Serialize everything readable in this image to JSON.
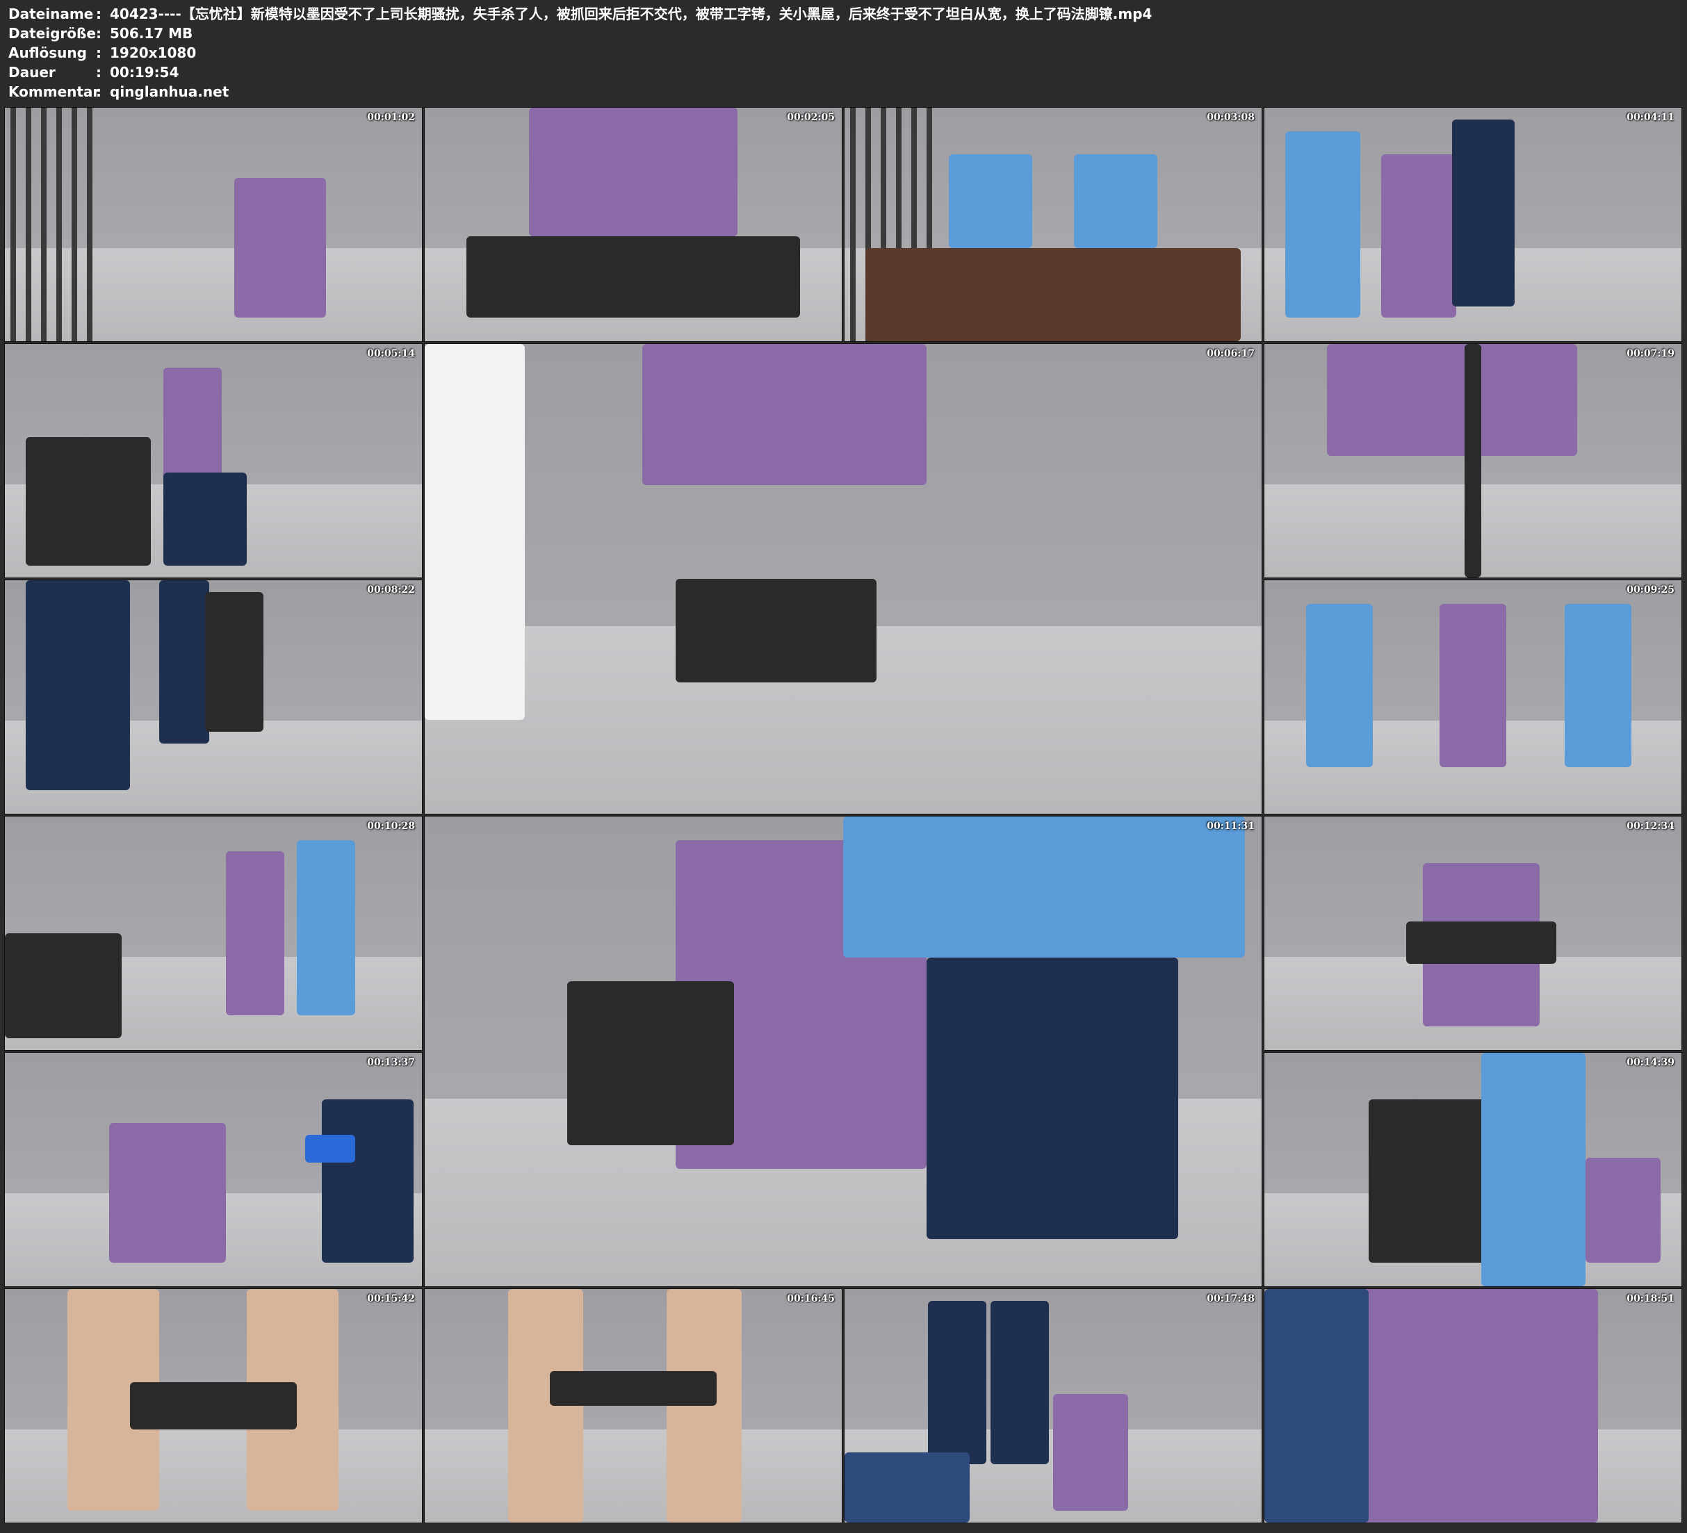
{
  "meta": {
    "rows": [
      {
        "key": "Dateiname",
        "value": "40423----【忘忧社】新模特以墨因受不了上司长期骚扰，失手杀了人，被抓回来后拒不交代，被带工字铐，关小黑屋，后来终于受不了坦白从宽，换上了码法脚镣.mp4"
      },
      {
        "key": "Dateigröße",
        "value": "506.17 MB"
      },
      {
        "key": "Auflösung",
        "value": "1920x1080"
      },
      {
        "key": "Dauer",
        "value": "00:19:54"
      },
      {
        "key": "Kommentar",
        "value": "qinglanhua.net"
      }
    ],
    "separator": ":"
  },
  "thumbnails": [
    {
      "time": "00:01:02"
    },
    {
      "time": "00:02:05"
    },
    {
      "time": "00:03:08"
    },
    {
      "time": "00:04:11"
    },
    {
      "time": "00:05:14"
    },
    {
      "time": "00:06:17"
    },
    {
      "time": "00:07:19"
    },
    {
      "time": "00:08:22"
    },
    {
      "time": "00:09:25"
    },
    {
      "time": "00:10:28"
    },
    {
      "time": "00:11:31"
    },
    {
      "time": "00:12:34"
    },
    {
      "time": "00:13:37"
    },
    {
      "time": "00:14:39"
    },
    {
      "time": "00:15:42"
    },
    {
      "time": "00:16:45"
    },
    {
      "time": "00:17:48"
    },
    {
      "time": "00:18:51"
    }
  ],
  "colors": {
    "background": "#2b2b2b",
    "wall": "#a9a9ad",
    "floor": "#c9c9cc",
    "dress": "#8b6aa8",
    "uniform_shirt": "#5b9bd8",
    "uniform_skirt": "#1f2f4f",
    "metal": "#2a2a2a"
  }
}
